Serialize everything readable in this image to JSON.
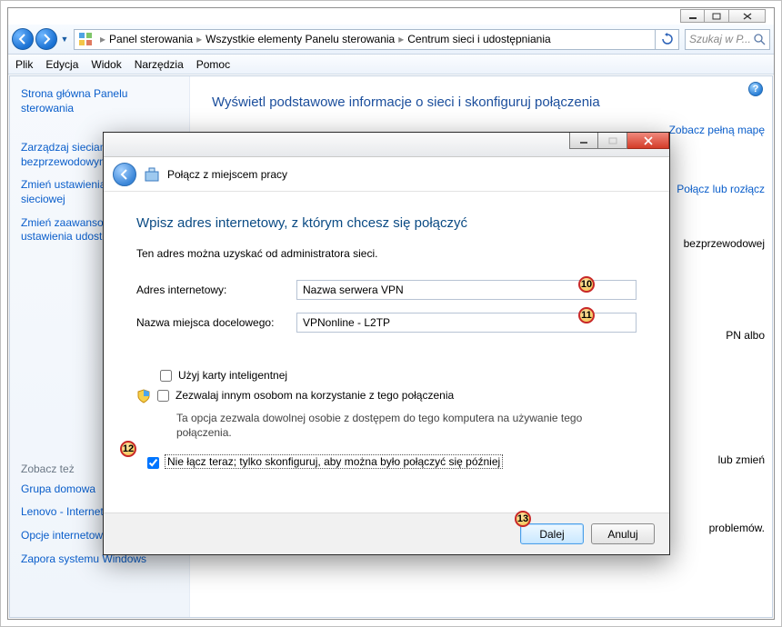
{
  "parent_window": {
    "breadcrumb": [
      "Panel sterowania",
      "Wszystkie elementy Panelu sterowania",
      "Centrum sieci i udostępniania"
    ],
    "search_placeholder": "Szukaj w P...",
    "menu": [
      "Plik",
      "Edycja",
      "Widok",
      "Narzędzia",
      "Pomoc"
    ],
    "sidebar": {
      "top_links": [
        "Strona główna Panelu sterowania",
        "Zarządzaj sieciami bezprzewodowymi",
        "Zmień ustawienia karty sieciowej",
        "Zmień zaawansowane ustawienia udostępniania"
      ],
      "see_also_label": "Zobacz też",
      "see_also_links": [
        "Grupa domowa",
        "Lenovo - Internet Connection",
        "Opcje internetowe",
        "Zapora systemu Windows"
      ]
    },
    "main_title": "Wyświetl podstawowe informacje o sieci i skonfiguruj połączenia",
    "bg_links": {
      "map": "Zobacz pełną mapę",
      "connect": "Połącz lub rozłącz",
      "wireless": "bezprzewodowej",
      "vpn": "PN albo",
      "change": "lub zmień",
      "issues": "problemów."
    }
  },
  "dialog": {
    "header_title": "Połącz z miejscem pracy",
    "heading": "Wpisz adres internetowy, z którym chcesz się połączyć",
    "subtitle": "Ten adres można uzyskać od administratora sieci.",
    "addr_label": "Adres internetowy:",
    "addr_value": "Nazwa serwera VPN",
    "name_label": "Nazwa miejsca docelowego:",
    "name_value": "VPNonline - L2TP",
    "chk_smartcard": "Użyj karty inteligentnej",
    "chk_allow": "Zezwalaj innym osobom na korzystanie z tego połączenia",
    "allow_hint": "Ta opcja zezwala dowolnej osobie z dostępem do tego komputera na używanie tego połączenia.",
    "chk_later": "Nie łącz teraz; tylko skonfiguruj, aby można było połączyć się później",
    "btn_next": "Dalej",
    "btn_cancel": "Anuluj"
  },
  "callouts": {
    "c10": "10",
    "c11": "11",
    "c12": "12",
    "c13": "13"
  }
}
